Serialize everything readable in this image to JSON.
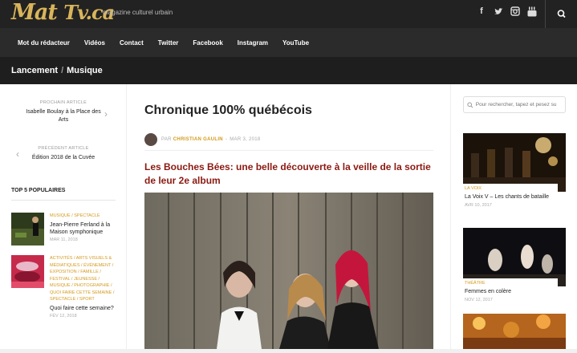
{
  "site": {
    "logo_main": "Mat",
    "logo_tv": "Tv.ca",
    "tagline": "magazine culturel urbain",
    "social_icons": [
      "facebook-icon",
      "twitter-icon",
      "instagram-icon",
      "youtube-icon"
    ],
    "social_glyphs": [
      "f",
      "t",
      "▣",
      "You"
    ],
    "accent": "#d49a1e",
    "headline_color": "#8b1a12"
  },
  "nav": {
    "items": [
      "Mot du rédacteur",
      "Vidéos",
      "Contact",
      "Twitter",
      "Facebook",
      "Instagram",
      "YouTube"
    ]
  },
  "breadcrumb": {
    "first": "Lancement",
    "separator": "/",
    "second": "Musique"
  },
  "left": {
    "next_label": "PROCHAIN ARTICLE",
    "next_title": "Isabelle Boulay à la Place des Arts",
    "prev_label": "PRÉCÉDENT ARTICLE",
    "prev_title": "Édition 2018 de la Cuvée",
    "top5_heading": "TOP 5 POPULAIRES",
    "popular": [
      {
        "cats": "MUSIQUE / SPECTACLE",
        "title": "Jean-Pierre Ferland à la Maison symphonique",
        "date": "MAR 11, 2018"
      },
      {
        "cats": "ACTIVITÉS / ARTS VISUELS & MÉDIATIQUES / ÉVÉNEMENT / EXPOSITION / FAMILLE / FESTIVAL / JEUNESSE / MUSIQUE / PHOTOGRAPHIE / QUOI FAIRE CETTE SEMAINE / SPECTACLE / SPORT",
        "title": "Quoi faire cette semaine?",
        "date": "FÉV 12, 2018"
      }
    ]
  },
  "article": {
    "title": "Chronique 100% québécois",
    "by": "PAR",
    "author": "CHRISTIAN GAULIN",
    "date_prefix": "-",
    "date": "MAR 3, 2018",
    "headline": "Les Bouches Bées: une belle découverte à la veille de la sortie de leur 2e album"
  },
  "right": {
    "search_placeholder": "Pour rechercher, tapez et pesez su",
    "cards": [
      {
        "cat": "LA VOIX",
        "title": "La Voix V – Les chants de bataille",
        "date": "AVR 10, 2017"
      },
      {
        "cat": "THÉÂTRE",
        "title": "Femmes en colère",
        "date": "NOV 12, 2017"
      }
    ]
  }
}
